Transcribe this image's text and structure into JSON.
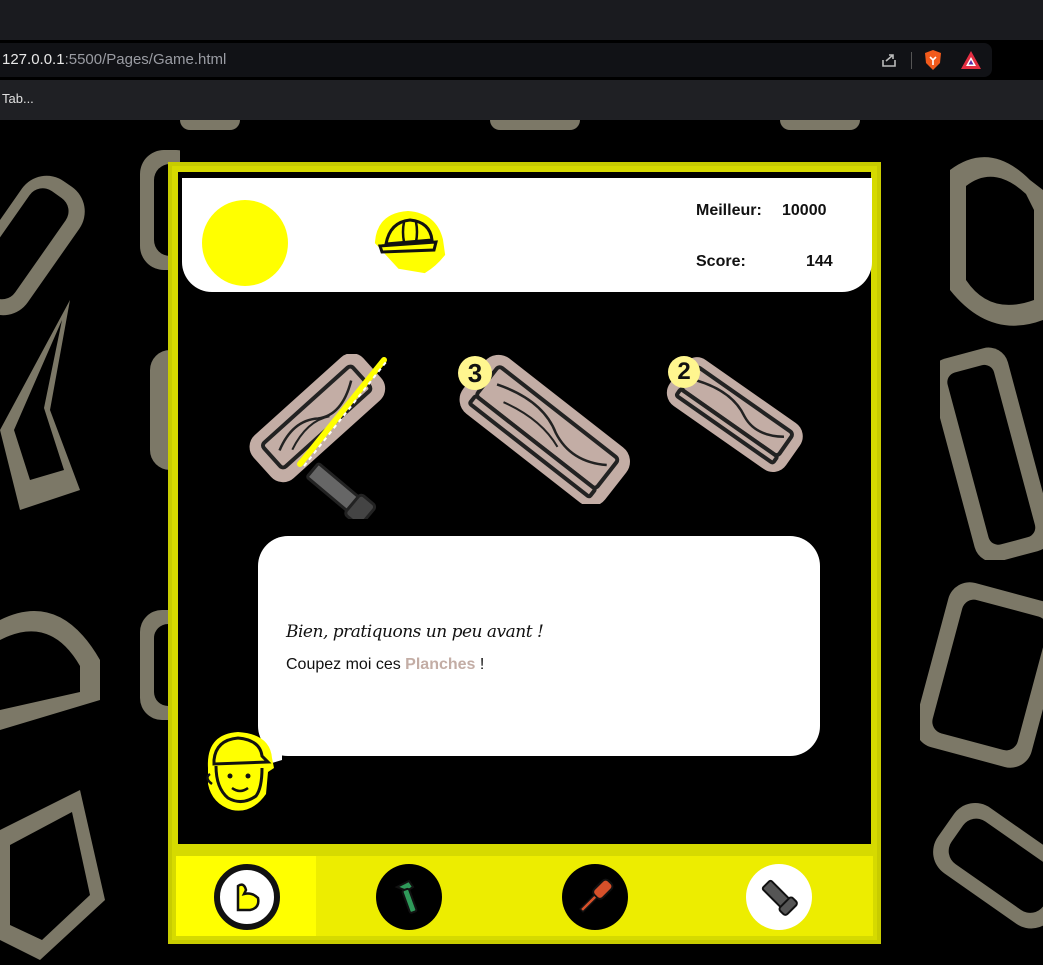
{
  "browser": {
    "url_host": "127.0.0.1",
    "url_rest": ":5500/Pages/Game.html",
    "bookmark": "Tab..."
  },
  "game": {
    "best_label": "Meilleur:",
    "best_value": "10000",
    "score_label": "Score:",
    "score_value": "144",
    "planks": [
      {
        "name": "plank-being-cut",
        "badge": ""
      },
      {
        "name": "plank-3",
        "badge": "3"
      },
      {
        "name": "plank-2",
        "badge": "2"
      }
    ],
    "dialog": {
      "line1": "Bien, pratiquons un peu avant !",
      "line2_prefix": "Coupez moi ces ",
      "line2_highlight": "Planches",
      "line2_suffix": " !"
    },
    "tools": [
      {
        "name": "strength-icon",
        "state": "active"
      },
      {
        "name": "hammer-icon",
        "state": "normal"
      },
      {
        "name": "screwdriver-icon",
        "state": "normal"
      },
      {
        "name": "saw-icon",
        "state": "selected"
      }
    ]
  },
  "colors": {
    "accent_yellow": "#ffff00",
    "frame_yellow": "#d6da00",
    "plank_tan": "#c3ada5",
    "pattern_olive": "#7c7867"
  }
}
